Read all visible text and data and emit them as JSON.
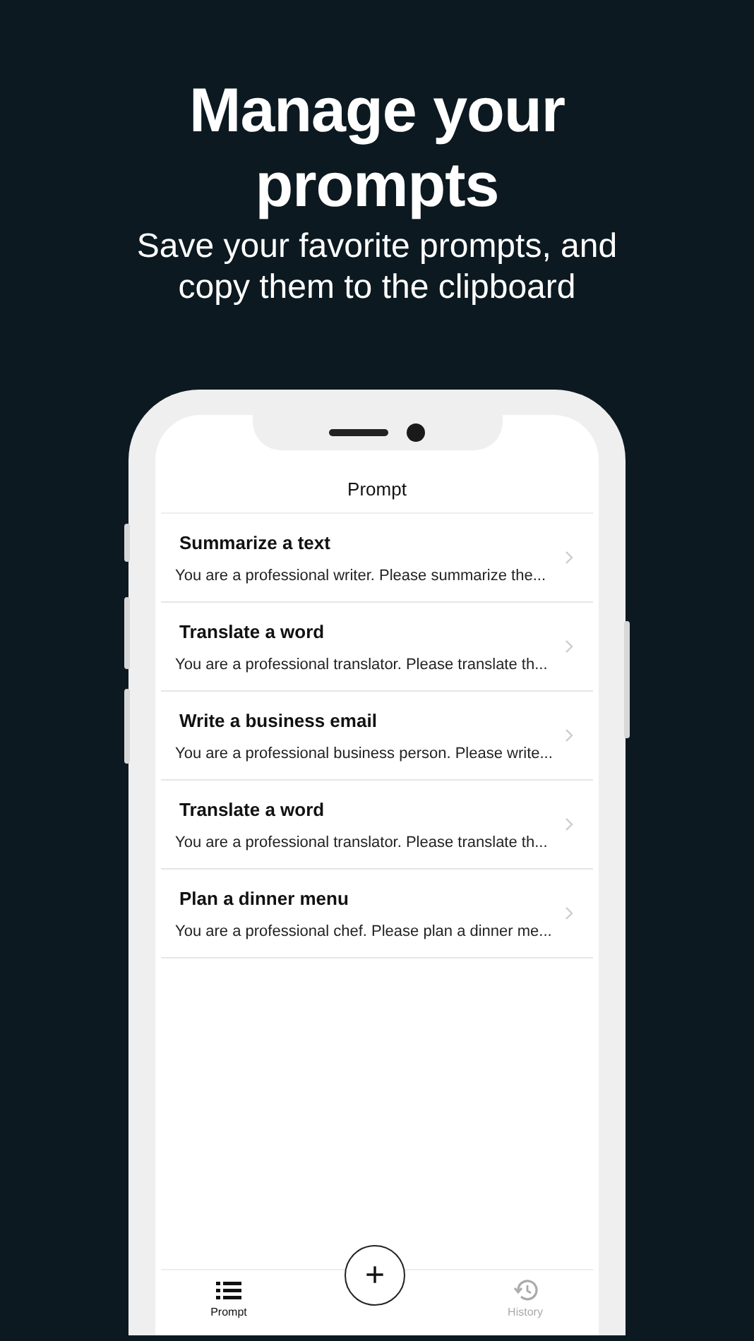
{
  "headline": {
    "title": "Manage your prompts",
    "subtitle": "Save your favorite prompts, and copy them to the clipboard"
  },
  "screen": {
    "title": "Prompt",
    "prompts": [
      {
        "title": "Summarize a text",
        "preview": "You are a professional writer. Please summarize the..."
      },
      {
        "title": "Translate a word",
        "preview": "You are a professional translator. Please translate th..."
      },
      {
        "title": "Write a business email",
        "preview": "You are a professional business person. Please write..."
      },
      {
        "title": "Translate a word",
        "preview": "You are a professional translator. Please translate th..."
      },
      {
        "title": "Plan a dinner menu",
        "preview": "You are a professional chef. Please plan a dinner me..."
      }
    ],
    "add_button": "+",
    "tabs": [
      {
        "label": "Prompt",
        "kind": "list",
        "selected": true
      },
      {
        "label": "History",
        "kind": "history",
        "selected": false
      }
    ]
  }
}
